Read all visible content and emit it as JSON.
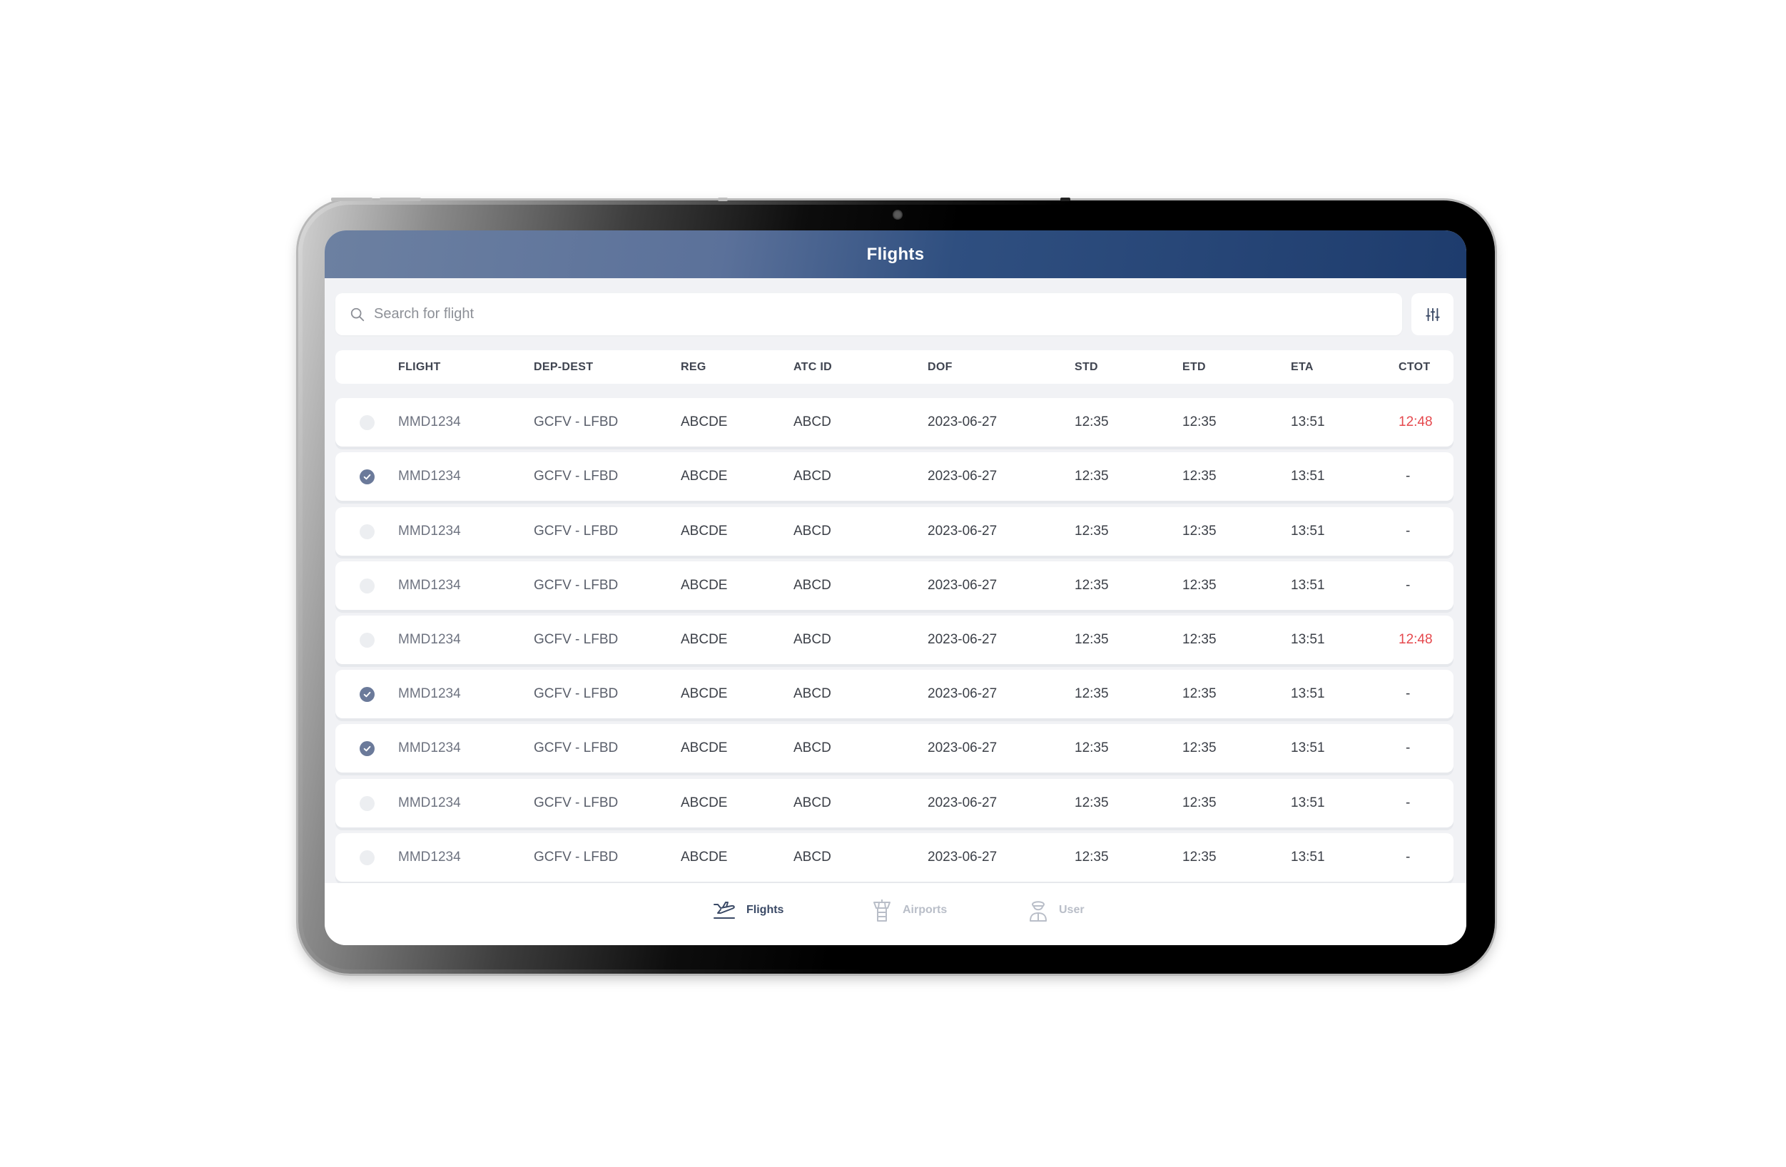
{
  "header": {
    "title": "Flights"
  },
  "search": {
    "placeholder": "Search for flight"
  },
  "table": {
    "columns": [
      "FLIGHT",
      "DEP-DEST",
      "REG",
      "ATC ID",
      "DOF",
      "STD",
      "ETD",
      "ETA",
      "CTOT"
    ],
    "rows": [
      {
        "checked": false,
        "flight": "MMD1234",
        "dep_dest": "GCFV - LFBD",
        "reg": "ABCDE",
        "atc_id": "ABCD",
        "dof": "2023-06-27",
        "std": "12:35",
        "etd": "12:35",
        "eta": "13:51",
        "ctot": "12:48",
        "ctot_alert": true
      },
      {
        "checked": true,
        "flight": "MMD1234",
        "dep_dest": "GCFV - LFBD",
        "reg": "ABCDE",
        "atc_id": "ABCD",
        "dof": "2023-06-27",
        "std": "12:35",
        "etd": "12:35",
        "eta": "13:51",
        "ctot": "-",
        "ctot_alert": false
      },
      {
        "checked": false,
        "flight": "MMD1234",
        "dep_dest": "GCFV - LFBD",
        "reg": "ABCDE",
        "atc_id": "ABCD",
        "dof": "2023-06-27",
        "std": "12:35",
        "etd": "12:35",
        "eta": "13:51",
        "ctot": "-",
        "ctot_alert": false
      },
      {
        "checked": false,
        "flight": "MMD1234",
        "dep_dest": "GCFV - LFBD",
        "reg": "ABCDE",
        "atc_id": "ABCD",
        "dof": "2023-06-27",
        "std": "12:35",
        "etd": "12:35",
        "eta": "13:51",
        "ctot": "-",
        "ctot_alert": false
      },
      {
        "checked": false,
        "flight": "MMD1234",
        "dep_dest": "GCFV - LFBD",
        "reg": "ABCDE",
        "atc_id": "ABCD",
        "dof": "2023-06-27",
        "std": "12:35",
        "etd": "12:35",
        "eta": "13:51",
        "ctot": "12:48",
        "ctot_alert": true
      },
      {
        "checked": true,
        "flight": "MMD1234",
        "dep_dest": "GCFV - LFBD",
        "reg": "ABCDE",
        "atc_id": "ABCD",
        "dof": "2023-06-27",
        "std": "12:35",
        "etd": "12:35",
        "eta": "13:51",
        "ctot": "-",
        "ctot_alert": false
      },
      {
        "checked": true,
        "flight": "MMD1234",
        "dep_dest": "GCFV - LFBD",
        "reg": "ABCDE",
        "atc_id": "ABCD",
        "dof": "2023-06-27",
        "std": "12:35",
        "etd": "12:35",
        "eta": "13:51",
        "ctot": "-",
        "ctot_alert": false
      },
      {
        "checked": false,
        "flight": "MMD1234",
        "dep_dest": "GCFV - LFBD",
        "reg": "ABCDE",
        "atc_id": "ABCD",
        "dof": "2023-06-27",
        "std": "12:35",
        "etd": "12:35",
        "eta": "13:51",
        "ctot": "-",
        "ctot_alert": false
      },
      {
        "checked": false,
        "flight": "MMD1234",
        "dep_dest": "GCFV - LFBD",
        "reg": "ABCDE",
        "atc_id": "ABCD",
        "dof": "2023-06-27",
        "std": "12:35",
        "etd": "12:35",
        "eta": "13:51",
        "ctot": "-",
        "ctot_alert": false
      }
    ]
  },
  "nav": {
    "items": [
      {
        "label": "Flights",
        "icon": "plane-icon",
        "active": true
      },
      {
        "label": "Airports",
        "icon": "control-tower-icon",
        "active": false
      },
      {
        "label": "User",
        "icon": "pilot-icon",
        "active": false
      }
    ]
  },
  "colors": {
    "header_start": "#6c80a1",
    "header_end": "#1e3c6d",
    "checkbox_checked": "#6b7a9a",
    "ctot_alert": "#e5484d",
    "nav_active": "#3b4a66",
    "nav_inactive": "#b9bec8"
  }
}
